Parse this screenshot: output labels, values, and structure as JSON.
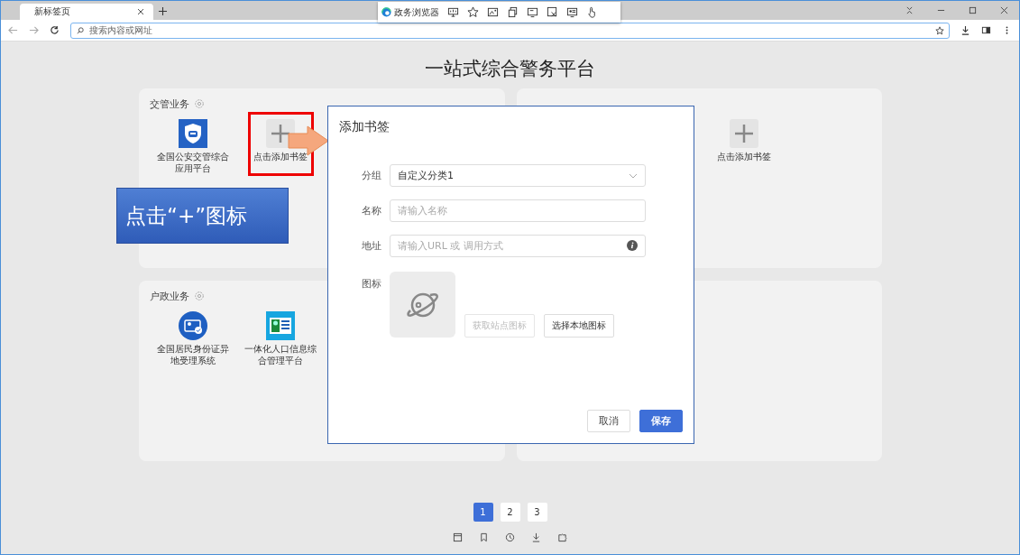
{
  "browser": {
    "tab": {
      "title": "新标签页"
    },
    "toolbar": {
      "label": "政务浏览器"
    },
    "address_bar": {
      "placeholder": "搜索内容或网址"
    }
  },
  "page": {
    "title": "一站式综合警务平台"
  },
  "sections": [
    {
      "kind": "group",
      "title": "交管业务",
      "items": [
        {
          "kind": "app",
          "label": "全国公安交管综合应用平台"
        },
        {
          "kind": "add",
          "label": "点击添加书签"
        }
      ]
    },
    {
      "kind": "group",
      "items": [
        {
          "kind": "add",
          "label": "点击添加书签"
        }
      ]
    },
    {
      "kind": "group",
      "title": "户政业务",
      "items": [
        {
          "kind": "app",
          "label": "全国居民身份证异地受理系统"
        },
        {
          "kind": "app",
          "label": "一体化人口信息综合管理平台"
        }
      ]
    },
    {
      "kind": "blank"
    }
  ],
  "dialog": {
    "title": "添加书签",
    "fields": [
      {
        "kind": "select",
        "label": "分组",
        "value": "自定义分类1"
      },
      {
        "kind": "text",
        "label": "名称",
        "placeholder": "请输入名称"
      },
      {
        "kind": "info",
        "label": "地址",
        "placeholder": "请输入URL 或 调用方式"
      }
    ],
    "icon_label": "图标",
    "icon_buttons": [
      {
        "label": "获取站点图标",
        "disabled": true
      },
      {
        "label": "选择本地图标",
        "disabled": false
      }
    ],
    "buttons": [
      {
        "kind": "default",
        "label": "取消"
      },
      {
        "kind": "primary",
        "label": "保存"
      }
    ]
  },
  "callout": {
    "text": "点击“+”图标"
  },
  "pagination": [
    {
      "label": "1",
      "selected": true
    },
    {
      "label": "2",
      "selected": false
    },
    {
      "label": "3",
      "selected": false
    }
  ]
}
